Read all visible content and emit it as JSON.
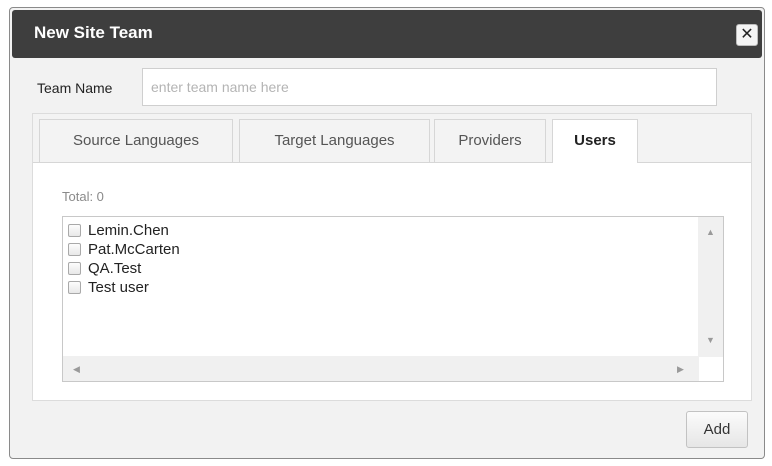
{
  "dialog": {
    "title": "New Site Team",
    "close_glyph": "✕"
  },
  "form": {
    "team_name_label": "Team Name",
    "team_name_value": "",
    "team_name_placeholder": "enter team name here"
  },
  "tabs": [
    {
      "label": "Source Languages",
      "active": false
    },
    {
      "label": "Target Languages",
      "active": false
    },
    {
      "label": "Providers",
      "active": false
    },
    {
      "label": "Users",
      "active": true
    }
  ],
  "users": {
    "total_text": "Total: 0",
    "items": [
      {
        "name": "Lemin.Chen",
        "checked": false
      },
      {
        "name": "Pat.McCarten",
        "checked": false
      },
      {
        "name": "QA.Test",
        "checked": false
      },
      {
        "name": "Test user",
        "checked": false
      }
    ],
    "scroll_glyphs": {
      "up": "▲",
      "down": "▼",
      "left": "◀",
      "right": "▶"
    }
  },
  "actions": {
    "add_label": "Add"
  },
  "colors": {
    "titlebar": "#3e3e3e",
    "dialog_bg": "#f2f2f2",
    "panel_bg": "#ffffff"
  }
}
